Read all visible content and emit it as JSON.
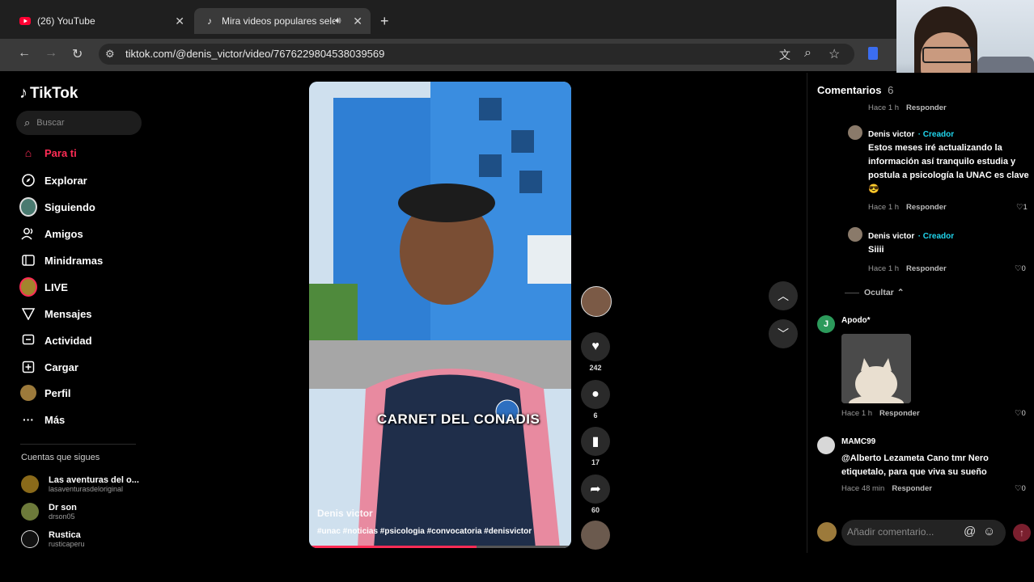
{
  "browser": {
    "tabs": [
      {
        "title": "(26) YouTube",
        "icon": "youtube-icon"
      },
      {
        "title": "Mira videos populares sele",
        "icon": "tiktok-icon"
      }
    ],
    "url": "tiktok.com/@denis_victor/video/7676229804538039569"
  },
  "sidebar": {
    "brand": "TikTok",
    "search_placeholder": "Buscar",
    "nav": [
      {
        "label": "Para ti",
        "icon": "home-icon",
        "active": true
      },
      {
        "label": "Explorar",
        "icon": "compass-icon"
      },
      {
        "label": "Siguiendo",
        "icon": "following-avatar-icon"
      },
      {
        "label": "Amigos",
        "icon": "friends-icon"
      },
      {
        "label": "Minidramas",
        "icon": "film-icon"
      },
      {
        "label": "LIVE",
        "icon": "live-icon"
      },
      {
        "label": "Mensajes",
        "icon": "send-icon"
      },
      {
        "label": "Actividad",
        "icon": "activity-icon"
      },
      {
        "label": "Cargar",
        "icon": "upload-icon"
      },
      {
        "label": "Perfil",
        "icon": "profile-icon"
      },
      {
        "label": "Más",
        "icon": "more-icon"
      }
    ],
    "following_title": "Cuentas que sigues",
    "following": [
      {
        "name": "Las aventuras del o...",
        "handle": "lasaventurasdeloriginal",
        "color": "#8a6a1a"
      },
      {
        "name": "Dr son",
        "handle": "drson05",
        "color": "#6d7a3a"
      },
      {
        "name": "Rustica",
        "handle": "rusticaperu",
        "color": "#111111"
      }
    ]
  },
  "video": {
    "caption": "CARNET DEL CONADIS",
    "author": "Denis victor",
    "hashtags": "#unac #noticias #psicologia #convocatoria #denisvictor",
    "progress": 0.64
  },
  "actions": {
    "likes": "242",
    "comments": "6",
    "saves": "17",
    "shares": "60"
  },
  "comments_panel": {
    "title": "Comentarios",
    "count": "6",
    "partial_meta": "Hace 1 h",
    "partial_reply": "Responder",
    "comments": [
      {
        "name": "Denis victor",
        "badge": "· Creador",
        "text": "Estos meses iré actualizando la información así tranquilo estudia y postula a psicología la UNAC es clave 😎",
        "time": "Hace 1 h",
        "reply": "Responder",
        "likes": "1"
      },
      {
        "name": "Denis victor",
        "badge": "· Creador",
        "text": "Siiii",
        "time": "Hace 1 h",
        "reply": "Responder",
        "likes": "0"
      },
      {
        "name": "Apodo*",
        "badge": "",
        "text": "",
        "time": "Hace 1 h",
        "reply": "Responder",
        "likes": "0",
        "avatar_letter": "J"
      },
      {
        "name": "MAMC99",
        "badge": "",
        "text": "@Alberto Lezameta Cano tmr Nero etiquetalo, para que viva su sueño",
        "time": "Hace 48 min",
        "reply": "Responder",
        "likes": "0"
      }
    ],
    "hide_label": "Ocultar",
    "input_placeholder": "Añadir comentario...",
    "accent": "#fe2c55",
    "creator_color": "#20d5ec"
  }
}
